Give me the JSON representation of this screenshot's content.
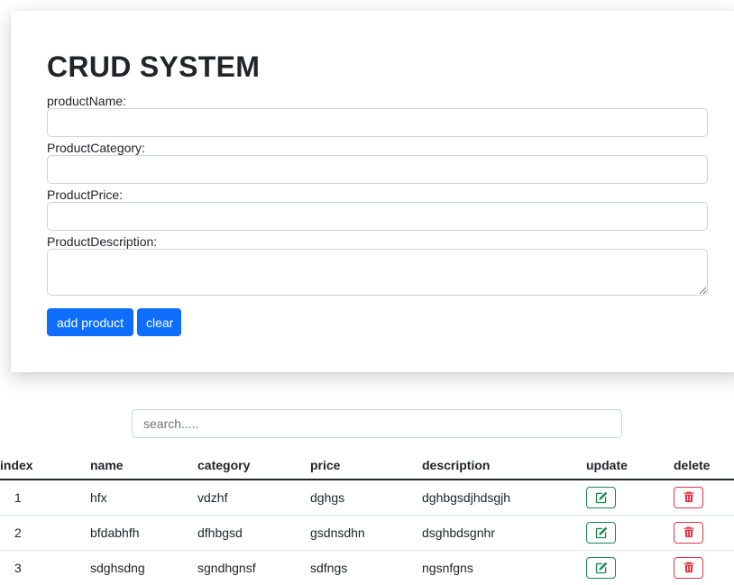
{
  "form": {
    "title": "CRUD SYSTEM",
    "name_label": "productName:",
    "category_label": "ProductCategory:",
    "price_label": "ProductPrice:",
    "description_label": "ProductDescription:",
    "add_label": "add product",
    "clear_label": "clear"
  },
  "search": {
    "placeholder": "search....."
  },
  "table": {
    "headers": [
      "index",
      "name",
      "category",
      "price",
      "description",
      "update",
      "delete"
    ],
    "rows": [
      {
        "index": "1",
        "name": "hfx",
        "category": "vdzhf",
        "price": "dghgs",
        "description": "dghbgsdjhdsgjh"
      },
      {
        "index": "2",
        "name": "bfdabhfh",
        "category": "dfhbgsd",
        "price": "gsdnsdhn",
        "description": "dsghbdsgnhr"
      },
      {
        "index": "3",
        "name": "sdghsdng",
        "category": "sgndhgnsf",
        "price": "sdfngs",
        "description": "ngsnfgns"
      }
    ]
  },
  "icons": {
    "update": "edit-icon",
    "delete": "trash-icon"
  },
  "colors": {
    "primary": "#0d6efd",
    "success": "#198754",
    "danger": "#dc3545"
  }
}
